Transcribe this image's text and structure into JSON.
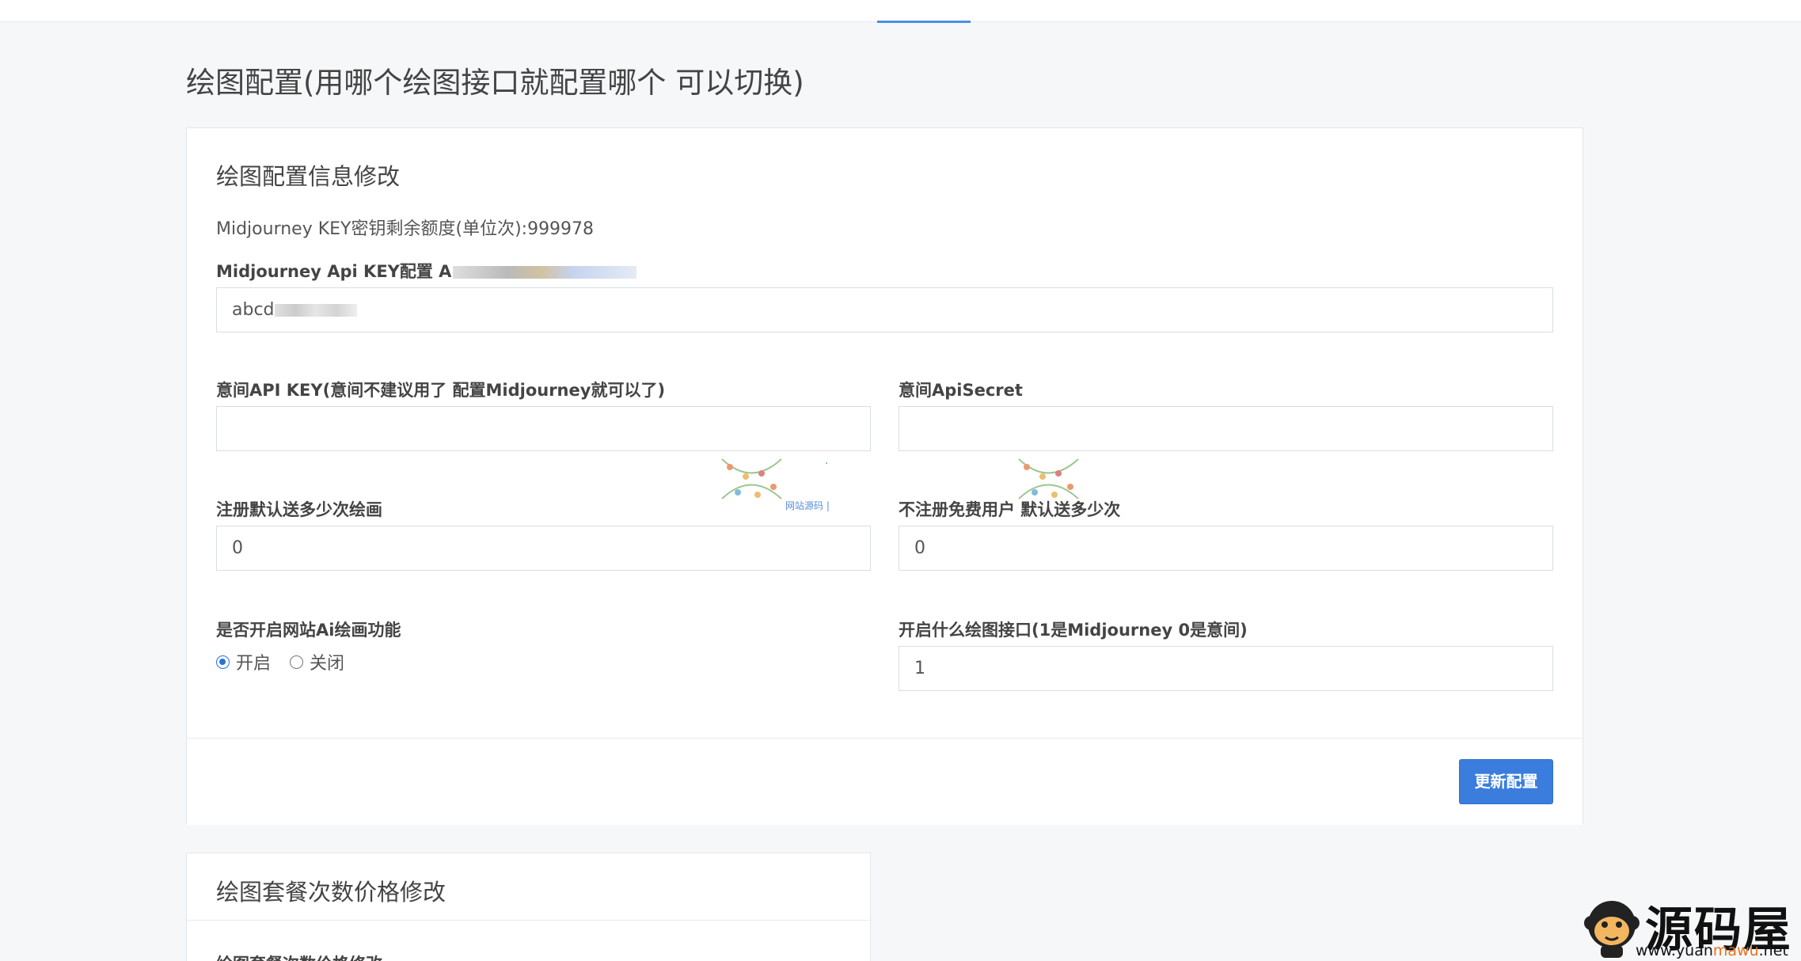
{
  "page_title": "绘图配置(用哪个绘图接口就配置哪个 可以切换)",
  "config_card": {
    "title": "绘图配置信息修改",
    "quota_text": "Midjourney KEY密钥剩余额度(单位次):999978",
    "mj_key_label": "Midjourney Api KEY配置 A",
    "mj_key_value": "abcd",
    "yijian_key_label": "意间API KEY(意间不建议用了 配置Midjourney就可以了)",
    "yijian_key_value": "",
    "yijian_secret_label": "意间ApiSecret",
    "yijian_secret_value": "",
    "register_gift_label": "注册默认送多少次绘画",
    "register_gift_value": "0",
    "guest_gift_label": "不注册免费用户 默认送多少次",
    "guest_gift_value": "0",
    "ai_draw_label": "是否开启网站Ai绘画功能",
    "ai_draw_options": [
      "开启",
      "关闭"
    ],
    "ai_draw_selected": "开启",
    "api_switch_label": "开启什么绘图接口(1是Midjourney 0是意间)",
    "api_switch_value": "1",
    "submit_label": "更新配置"
  },
  "package_card": {
    "title": "绘图套餐次数价格修改",
    "subtitle": "绘图套餐次数价格修改"
  },
  "watermark": {
    "main_text": "·",
    "sub_text": "网站源码 |"
  },
  "logo": {
    "brand": "源码屋",
    "domain_prefix": "www.yuan",
    "domain_highlight": "mawu",
    "domain_suffix": ".net"
  },
  "colors": {
    "primary": "#3b7ddd",
    "background": "#f5f7f9",
    "logo_accent": "#e8731c"
  }
}
